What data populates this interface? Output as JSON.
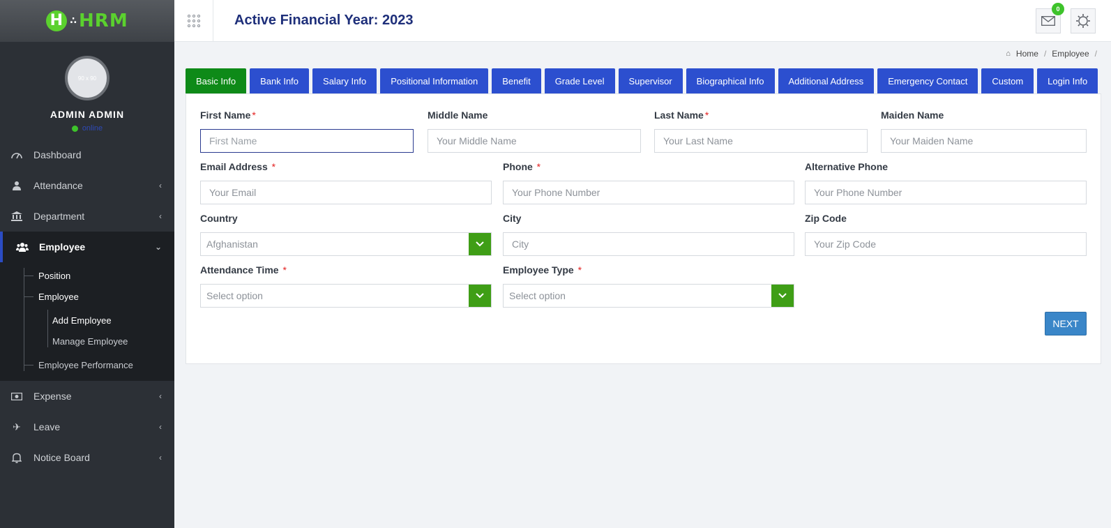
{
  "logo": {
    "text": "HRM",
    "letter": "H"
  },
  "profile": {
    "avatar_text": "90 x 90",
    "name": "ADMIN ADMIN",
    "status": "online"
  },
  "sidebar": {
    "items": [
      {
        "label": "Dashboard",
        "icon": "dashboard-icon"
      },
      {
        "label": "Attendance",
        "icon": "user-icon"
      },
      {
        "label": "Department",
        "icon": "bank-icon"
      },
      {
        "label": "Employee",
        "icon": "users-icon"
      },
      {
        "label": "Expense",
        "icon": "money-icon"
      },
      {
        "label": "Leave",
        "icon": "plane-icon"
      },
      {
        "label": "Notice Board",
        "icon": "bell-icon"
      }
    ],
    "employee_sub": {
      "position": "Position",
      "employee": "Employee",
      "add_employee": "Add Employee",
      "manage_employee": "Manage Employee",
      "performance": "Employee Performance"
    }
  },
  "header": {
    "title": "Active Financial Year: 2023",
    "mail_badge": "0"
  },
  "breadcrumb": {
    "home": "Home",
    "current": "Employee",
    "sep": "/"
  },
  "tabs": [
    "Basic Info",
    "Bank Info",
    "Salary Info",
    "Positional Information",
    "Benefit",
    "Grade Level",
    "Supervisor",
    "Biographical Info",
    "Additional Address",
    "Emergency Contact",
    "Custom",
    "Login Info"
  ],
  "form": {
    "first_name": {
      "label": "First Name",
      "placeholder": "First Name"
    },
    "middle_name": {
      "label": "Middle Name",
      "placeholder": "Your Middle Name"
    },
    "last_name": {
      "label": "Last Name",
      "placeholder": "Your Last Name"
    },
    "maiden_name": {
      "label": "Maiden Name",
      "placeholder": "Your Maiden Name"
    },
    "email": {
      "label": "Email Address",
      "placeholder": "Your Email"
    },
    "phone": {
      "label": "Phone",
      "placeholder": "Your Phone Number"
    },
    "alt_phone": {
      "label": "Alternative Phone",
      "placeholder": "Your Phone Number"
    },
    "country": {
      "label": "Country",
      "value": "Afghanistan"
    },
    "city": {
      "label": "City",
      "placeholder": "City"
    },
    "zip": {
      "label": "Zip Code",
      "placeholder": "Your Zip Code"
    },
    "attendance_time": {
      "label": "Attendance Time",
      "value": "Select option"
    },
    "employee_type": {
      "label": "Employee Type",
      "value": "Select option"
    },
    "required_mark": "*",
    "next_label": "NEXT"
  },
  "colors": {
    "accent": "#2c4fcf",
    "active_tab": "#0e8a18",
    "select_btn": "#3f9e16",
    "next": "#3a86c8"
  }
}
